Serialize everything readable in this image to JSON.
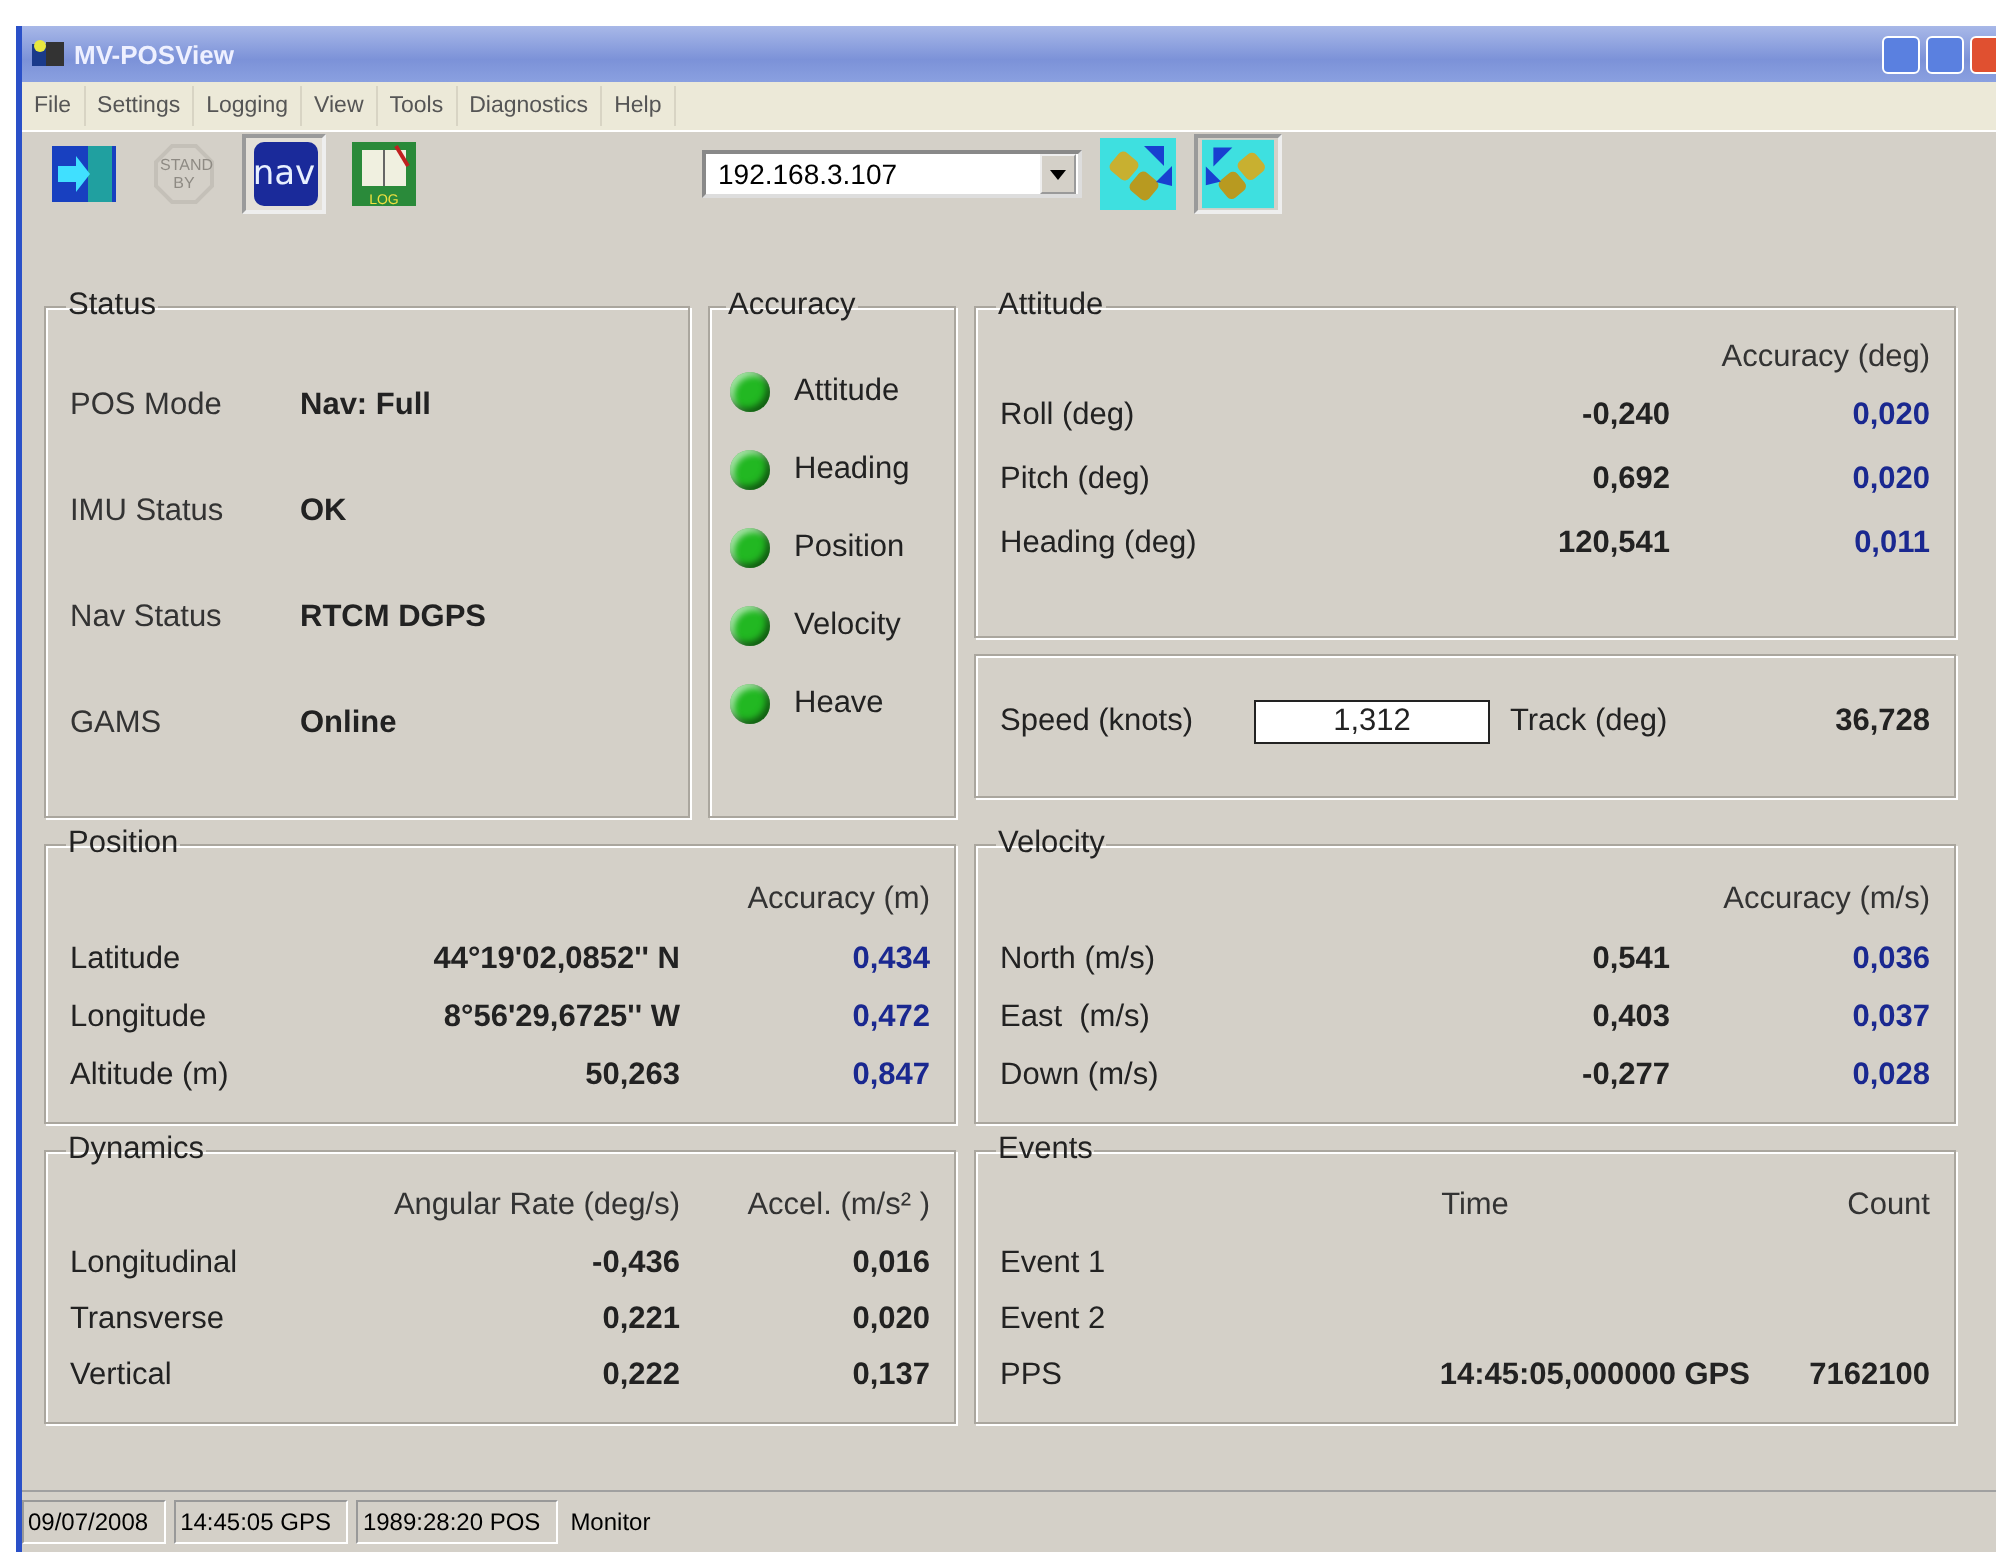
{
  "window": {
    "title": "MV-POSView"
  },
  "menu": [
    "File",
    "Settings",
    "Logging",
    "View",
    "Tools",
    "Diagnostics",
    "Help"
  ],
  "toolbar": [
    {
      "kind": "exit",
      "pressed": false,
      "disabled": false
    },
    {
      "kind": "standby",
      "label": "STAND BY",
      "pressed": false,
      "disabled": true
    },
    {
      "kind": "nav",
      "label": "nav",
      "pressed": true,
      "disabled": false
    },
    {
      "kind": "log",
      "label": "LOG",
      "pressed": false,
      "disabled": false
    }
  ],
  "ip_field": {
    "value": "192.168.3.107"
  },
  "connect_buttons": [
    {
      "kind": "connect",
      "pressed": false
    },
    {
      "kind": "disconnect",
      "pressed": true
    }
  ],
  "status": {
    "title": "Status",
    "rows": [
      {
        "label": "POS Mode",
        "value": "Nav: Full"
      },
      {
        "label": "IMU Status",
        "value": "OK"
      },
      {
        "label": "Nav Status",
        "value": "RTCM DGPS"
      },
      {
        "label": "GAMS",
        "value": "Online"
      }
    ]
  },
  "accuracy": {
    "title": "Accuracy",
    "items": [
      {
        "label": "Attitude",
        "color": "#22b822"
      },
      {
        "label": "Heading",
        "color": "#22b822"
      },
      {
        "label": "Position",
        "color": "#22b822"
      },
      {
        "label": "Velocity",
        "color": "#22b822"
      },
      {
        "label": "Heave",
        "color": "#22b822"
      }
    ]
  },
  "attitude": {
    "title": "Attitude",
    "column_header": "Accuracy (deg)",
    "rows": [
      {
        "label": "Roll (deg)",
        "value": "-0,240",
        "accuracy": "0,020"
      },
      {
        "label": "Pitch (deg)",
        "value": "0,692",
        "accuracy": "0,020"
      },
      {
        "label": "Heading (deg)",
        "value": "120,541",
        "accuracy": "0,011"
      }
    ]
  },
  "speed": {
    "label": "Speed (knots)",
    "value": "1,312",
    "track_label": "Track (deg)",
    "track_value": "36,728"
  },
  "position": {
    "title": "Position",
    "column_header": "Accuracy (m)",
    "rows": [
      {
        "label": "Latitude",
        "value": "44°19'02,0852'' N",
        "accuracy": "0,434"
      },
      {
        "label": "Longitude",
        "value": "8°56'29,6725'' W",
        "accuracy": "0,472"
      },
      {
        "label": "Altitude (m)",
        "value": "50,263",
        "accuracy": "0,847"
      }
    ]
  },
  "velocity": {
    "title": "Velocity",
    "column_header": "Accuracy (m/s)",
    "rows": [
      {
        "label": "North (m/s)",
        "value": "0,541",
        "accuracy": "0,036"
      },
      {
        "label": "East  (m/s)",
        "value": "0,403",
        "accuracy": "0,037"
      },
      {
        "label": "Down (m/s)",
        "value": "-0,277",
        "accuracy": "0,028"
      }
    ]
  },
  "dynamics": {
    "title": "Dynamics",
    "columns": [
      "Angular Rate (deg/s)",
      "Accel. (m/s² )"
    ],
    "rows": [
      {
        "label": "Longitudinal",
        "rate": "-0,436",
        "accel": "0,016"
      },
      {
        "label": "Transverse",
        "rate": "0,221",
        "accel": "0,020"
      },
      {
        "label": "Vertical",
        "rate": "0,222",
        "accel": "0,137"
      }
    ]
  },
  "events": {
    "title": "Events",
    "columns": [
      "Time",
      "Count"
    ],
    "rows": [
      {
        "label": "Event 1"
      },
      {
        "label": "Event 2"
      },
      {
        "label": "PPS",
        "time": "14:45:05,000000 GPS",
        "count": "7162100"
      }
    ]
  },
  "status_bar": [
    "09/07/2008",
    "14:45:05 GPS",
    "1989:28:20 POS",
    "Monitor"
  ]
}
